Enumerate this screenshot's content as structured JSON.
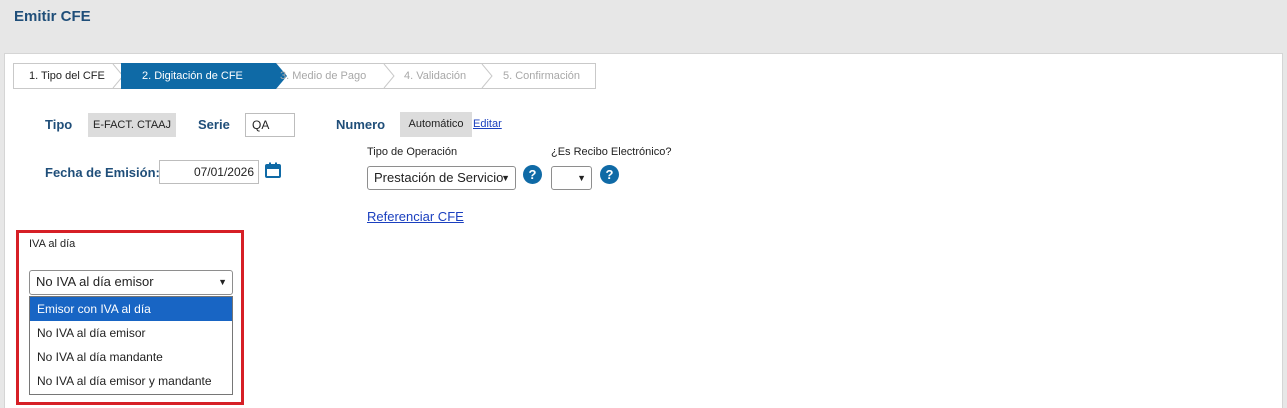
{
  "page": {
    "title": "Emitir CFE"
  },
  "wizard": {
    "steps": [
      {
        "label": "1. Tipo del CFE",
        "state": "done"
      },
      {
        "label": "2. Digitación de CFE",
        "state": "active"
      },
      {
        "label": "3. Medio de Pago",
        "state": "disabled"
      },
      {
        "label": "4. Validación",
        "state": "disabled"
      },
      {
        "label": "5. Confirmación",
        "state": "disabled"
      }
    ],
    "active_color": "#0f6aa6"
  },
  "form": {
    "tipo_label": "Tipo",
    "tipo_value": "E-FACT. CTAAJ",
    "serie_label": "Serie",
    "serie_value": "QA",
    "numero_label": "Numero",
    "numero_value": "Automático",
    "editar_link": "Editar",
    "fecha_label": "Fecha de Emisión:",
    "fecha_value": "07/01/2026",
    "calendar_icon": "calendar-icon",
    "tipo_operacion_label": "Tipo de Operación",
    "tipo_operacion_value": "Prestación de Servicio",
    "recibo_label": "¿Es Recibo Electrónico?",
    "recibo_value": "",
    "help_glyph": "?",
    "referenciar_link": "Referenciar CFE"
  },
  "iva": {
    "label": "IVA al día",
    "selected_value": "No IVA al día emisor",
    "options": [
      {
        "label": "Emisor con IVA al día",
        "highlighted": true
      },
      {
        "label": "No IVA al día emisor",
        "highlighted": false
      },
      {
        "label": "No IVA al día mandante",
        "highlighted": false
      },
      {
        "label": "No IVA al día emisor y mandante",
        "highlighted": false
      }
    ],
    "highlight_color": "#d61f26"
  }
}
